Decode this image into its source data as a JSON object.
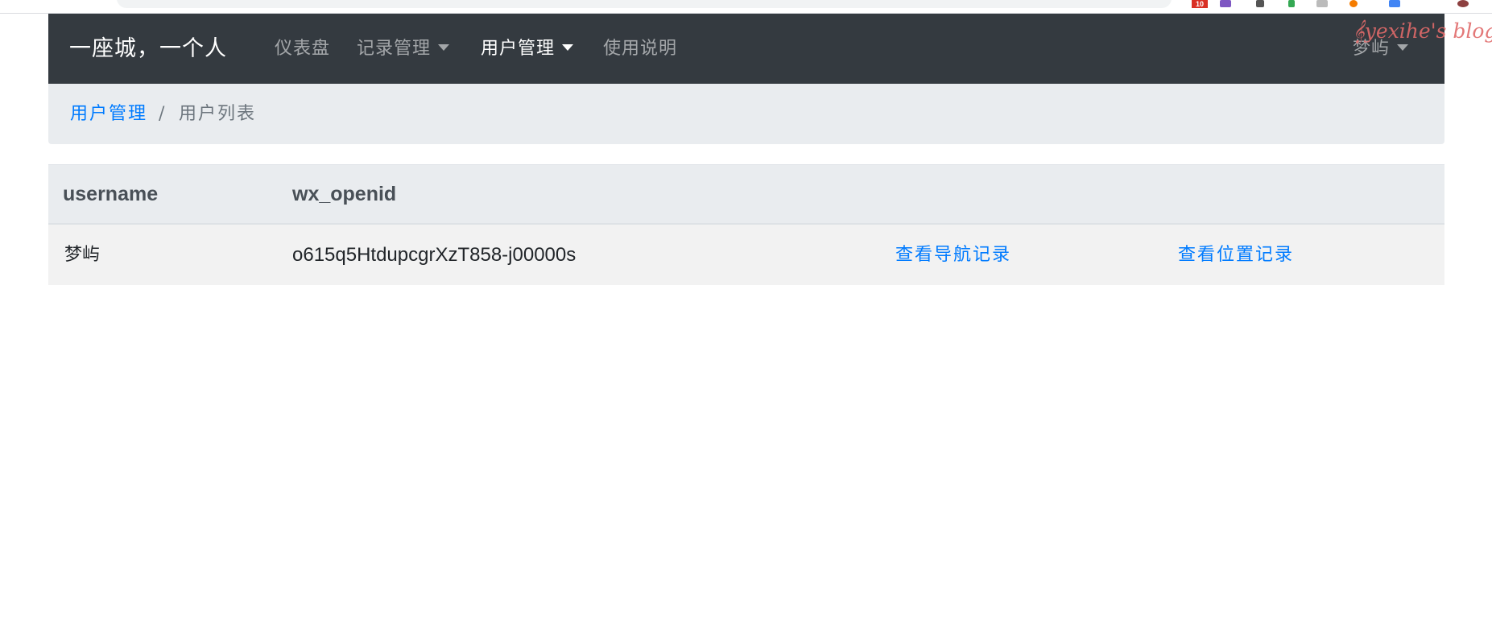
{
  "navbar": {
    "brand": "一座城，一个人",
    "items": [
      {
        "label": "仪表盘",
        "has_dropdown": false,
        "active": false
      },
      {
        "label": "记录管理",
        "has_dropdown": true,
        "active": false
      },
      {
        "label": "用户管理",
        "has_dropdown": true,
        "active": true
      },
      {
        "label": "使用说明",
        "has_dropdown": false,
        "active": false
      }
    ],
    "user_menu": {
      "label": "梦屿",
      "has_dropdown": true
    },
    "watermark": "yexihe's blog"
  },
  "browser": {
    "badge_count": "10"
  },
  "breadcrumb": {
    "items": [
      {
        "label": "用户管理",
        "is_link": true
      },
      {
        "label": "用户列表",
        "is_link": false
      }
    ],
    "separator": "/"
  },
  "table": {
    "columns": [
      "username",
      "wx_openid",
      "",
      ""
    ],
    "rows": [
      {
        "username": "梦屿",
        "wx_openid": "o615q5HtdupcgrXzT858-j00000s",
        "nav_link": "查看导航记录",
        "location_link": "查看位置记录"
      }
    ]
  },
  "colors": {
    "navbar_bg": "#343a40",
    "breadcrumb_bg": "#e9ecef",
    "link": "#007bff",
    "row_bg": "#f2f2f2"
  }
}
